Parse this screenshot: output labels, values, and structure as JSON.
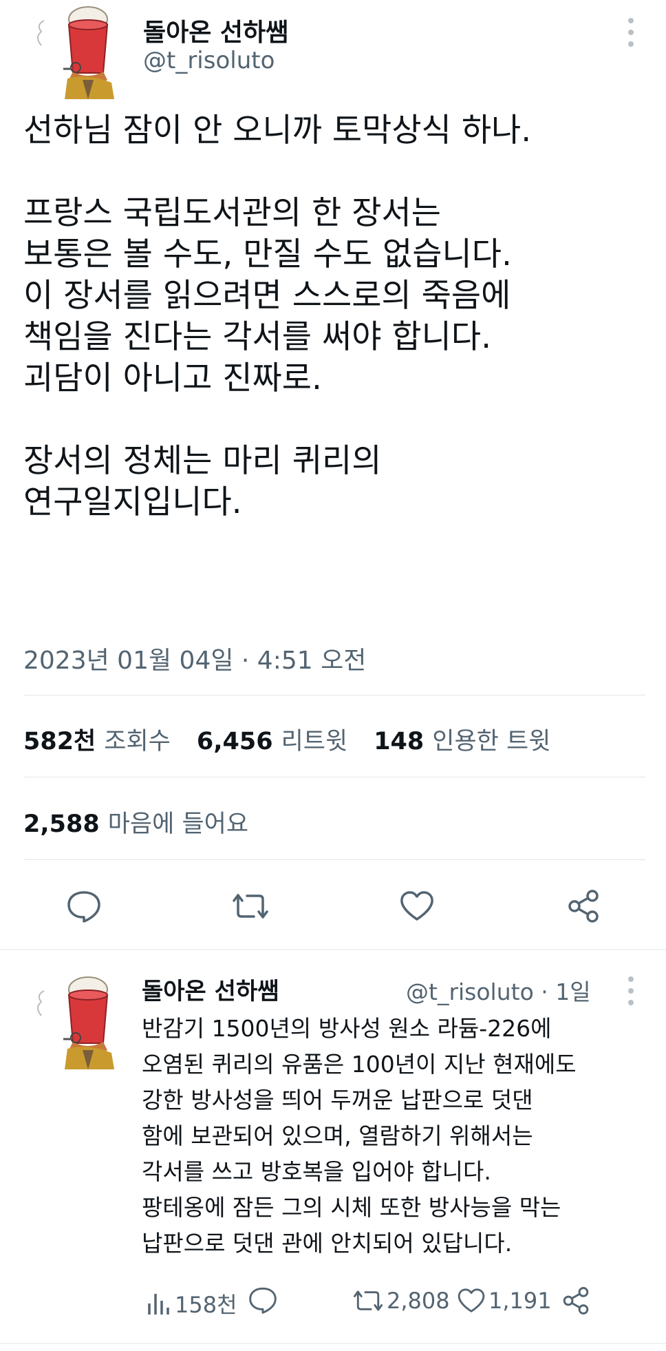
{
  "tweet": {
    "author_name": "돌아온 선하쌤",
    "handle": "@t_risoluto",
    "lines": [
      "선하님 잠이 안 오니까 토막상식 하나.",
      "",
      "프랑스 국립도서관의 한 장서는",
      "보통은 볼 수도, 만질 수도 없습니다.",
      "이 장서를 읽으려면 스스로의 죽음에",
      "책임을 진다는 각서를 써야 합니다.",
      "괴담이 아니고 진짜로.",
      "",
      "장서의 정체는 마리 퀴리의",
      "연구일지입니다."
    ],
    "timestamp": "2023년 01월 04일 · 4:51 오전",
    "stats": {
      "views_num": "582천",
      "views_label": "조회수",
      "retweets_num": "6,456",
      "retweets_label": "리트윗",
      "quotes_num": "148",
      "quotes_label": "인용한 트윗",
      "likes_num": "2,588",
      "likes_label": "마음에 들어요"
    },
    "actions": [
      "reply-icon",
      "retweet-icon",
      "like-icon",
      "share-icon"
    ]
  },
  "reply": {
    "author_name": "돌아온 선하쌤",
    "handle_time": "@t_risoluto · 1일",
    "lines": [
      "반감기 1500년의 방사성 원소 라듐-226에",
      "오염된 퀴리의 유품은 100년이 지난 현재에도",
      "강한 방사성을 띄어 두꺼운 납판으로 덧댄",
      "함에 보관되어 있으며, 열람하기 위해서는",
      "각서를 쓰고 방호복을 입어야 합니다.",
      "팡테옹에 잠든 그의 시체 또한 방사능을 막는",
      "납판으로 덧댄 관에 안치되어 있답니다."
    ],
    "views": "158천",
    "retweets": "2,808",
    "likes": "1,191"
  },
  "colors": {
    "text": "#0f1419",
    "secondary": "#536471",
    "divider": "#e1e5e8",
    "avatar_hat": "#d8383a"
  }
}
